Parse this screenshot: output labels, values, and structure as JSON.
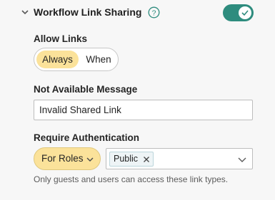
{
  "section": {
    "title": "Workflow Link Sharing",
    "collapse_icon": "chevron-down-icon",
    "help_icon": "question-circle-icon",
    "toggle_on": true,
    "accent_color": "#2e8c7e"
  },
  "allow_links": {
    "label": "Allow Links",
    "options": [
      "Always",
      "When"
    ],
    "selected": "Always",
    "highlight_color": "#fbe29a"
  },
  "not_available": {
    "label": "Not Available Message",
    "value": "Invalid Shared Link"
  },
  "require_auth": {
    "label": "Require Authentication",
    "dropdown_value": "For Roles",
    "tags": [
      "Public"
    ],
    "help_text": "Only guests and users can access these link types."
  }
}
